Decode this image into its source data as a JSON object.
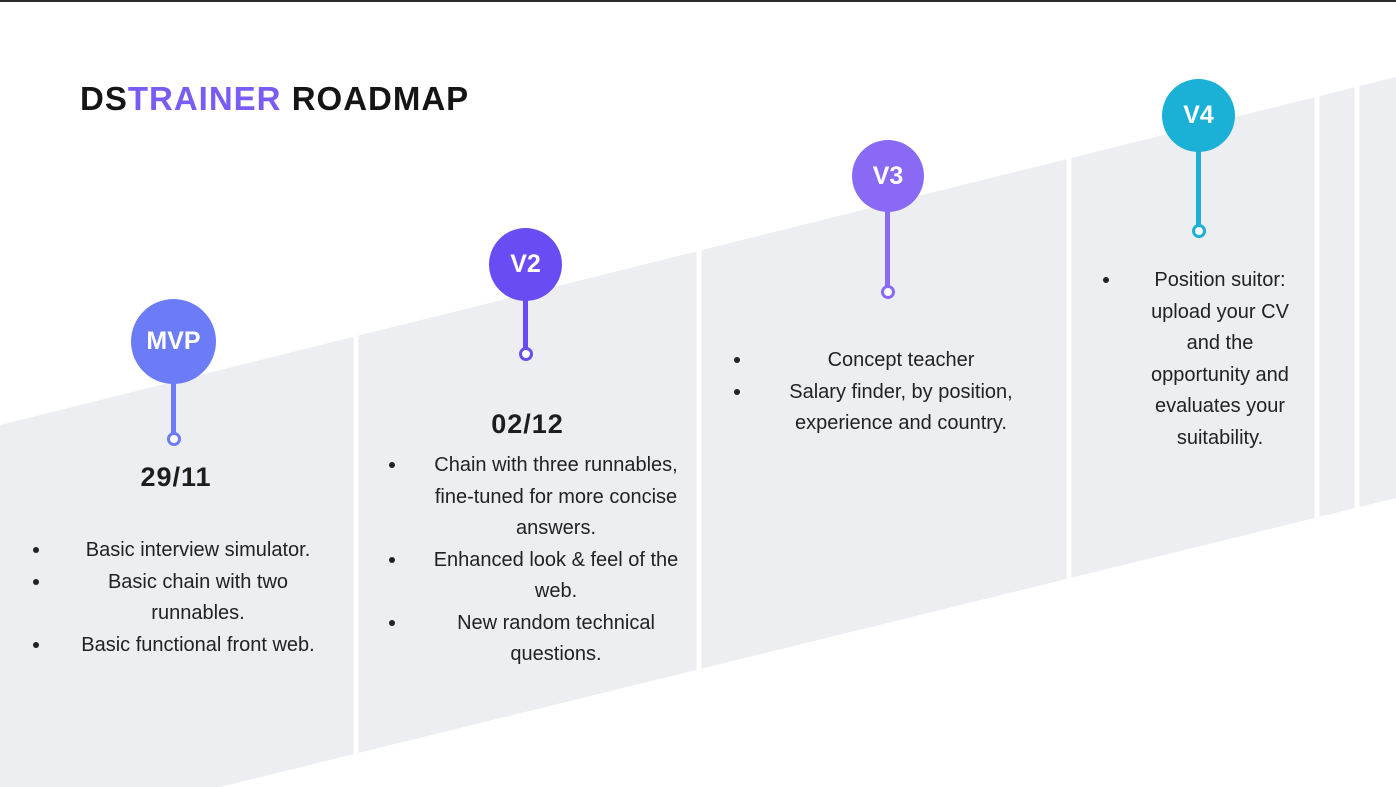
{
  "title": {
    "prefix": "DS",
    "accent": "TRAINER",
    "suffix": "ROADMAP"
  },
  "colors": {
    "band": "#eceef1",
    "title_accent": "#7a5cf5",
    "mvp": "#6b7cf6",
    "v2": "#6a4cf4",
    "v3": "#8a6af5",
    "v4": "#1bb0d6"
  },
  "milestones": [
    {
      "label": "MVP",
      "date": "29/11",
      "items": [
        "Basic interview simulator.",
        "Basic chain with two runnables.",
        "Basic functional front web."
      ]
    },
    {
      "label": "V2",
      "date": "02/12",
      "items": [
        "Chain with three runnables, fine-tuned for more concise answers.",
        "Enhanced look & feel of the web.",
        "New random technical questions."
      ]
    },
    {
      "label": "V3",
      "date": "",
      "items": [
        "Concept teacher",
        "Salary finder, by position, experience and country."
      ]
    },
    {
      "label": "V4",
      "date": "",
      "items": [
        "Position suitor: upload your CV and the opportunity and evaluates your suitability."
      ]
    }
  ]
}
